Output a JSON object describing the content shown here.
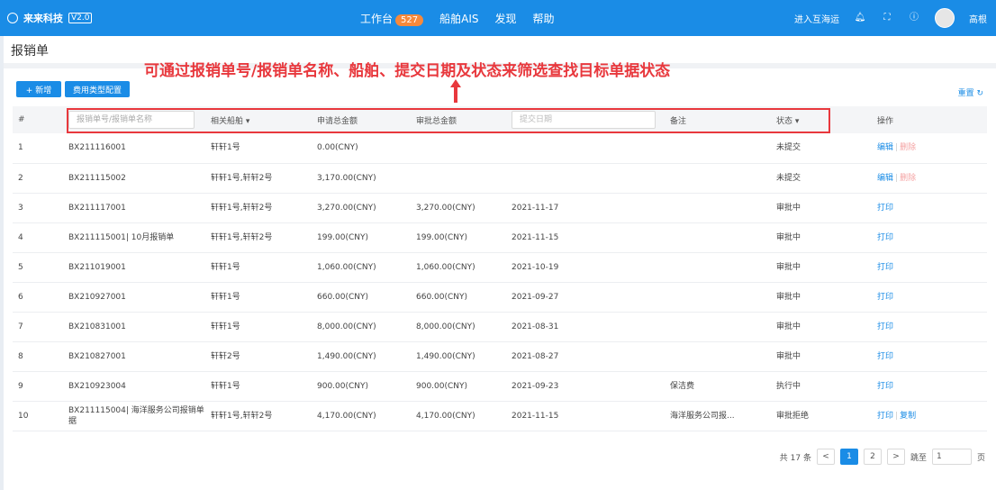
{
  "topbar": {
    "brand_name": "来来科技",
    "brand_version": "V2.0",
    "nav": [
      {
        "label": "工作台",
        "badge": "527"
      },
      {
        "label": "船舶AIS"
      },
      {
        "label": "发现"
      },
      {
        "label": "帮助"
      }
    ],
    "enter_label": "进入互海运",
    "user_name": "高根"
  },
  "page": {
    "title": "报销单",
    "annotation": "可通过报销单号/报销单名称、船舶、提交日期及状态来筛选查找目标单据状态",
    "new_button": "+ 新增",
    "config_button": "费用类型配置",
    "reset_label": "重置"
  },
  "table": {
    "headers": {
      "index": "#",
      "no_placeholder": "报销单号/报销单名称",
      "ship": "相关船舶",
      "apply_amount": "申请总金额",
      "approve_amount": "审批总金额",
      "date_placeholder": "提交日期",
      "remark": "备注",
      "status": "状态",
      "action": "操作"
    },
    "rows": [
      {
        "idx": "1",
        "no": "BX211116001",
        "ship": "轩轩1号",
        "apply": "0.00(CNY)",
        "approve": "",
        "date": "",
        "remark": "",
        "status": "未提交",
        "act1": "编辑",
        "act2": "删除"
      },
      {
        "idx": "2",
        "no": "BX211115002",
        "ship": "轩轩1号,轩轩2号",
        "apply": "3,170.00(CNY)",
        "approve": "",
        "date": "",
        "remark": "",
        "status": "未提交",
        "act1": "编辑",
        "act2": "删除"
      },
      {
        "idx": "3",
        "no": "BX211117001",
        "ship": "轩轩1号,轩轩2号",
        "apply": "3,270.00(CNY)",
        "approve": "3,270.00(CNY)",
        "date": "2021-11-17",
        "remark": "",
        "status": "审批中",
        "act1": "打印",
        "act2": ""
      },
      {
        "idx": "4",
        "no": "BX211115001| 10月报销单",
        "ship": "轩轩1号,轩轩2号",
        "apply": "199.00(CNY)",
        "approve": "199.00(CNY)",
        "date": "2021-11-15",
        "remark": "",
        "status": "审批中",
        "act1": "打印",
        "act2": ""
      },
      {
        "idx": "5",
        "no": "BX211019001",
        "ship": "轩轩1号",
        "apply": "1,060.00(CNY)",
        "approve": "1,060.00(CNY)",
        "date": "2021-10-19",
        "remark": "",
        "status": "审批中",
        "act1": "打印",
        "act2": ""
      },
      {
        "idx": "6",
        "no": "BX210927001",
        "ship": "轩轩1号",
        "apply": "660.00(CNY)",
        "approve": "660.00(CNY)",
        "date": "2021-09-27",
        "remark": "",
        "status": "审批中",
        "act1": "打印",
        "act2": ""
      },
      {
        "idx": "7",
        "no": "BX210831001",
        "ship": "轩轩1号",
        "apply": "8,000.00(CNY)",
        "approve": "8,000.00(CNY)",
        "date": "2021-08-31",
        "remark": "",
        "status": "审批中",
        "act1": "打印",
        "act2": ""
      },
      {
        "idx": "8",
        "no": "BX210827001",
        "ship": "轩轩2号",
        "apply": "1,490.00(CNY)",
        "approve": "1,490.00(CNY)",
        "date": "2021-08-27",
        "remark": "",
        "status": "审批中",
        "act1": "打印",
        "act2": ""
      },
      {
        "idx": "9",
        "no": "BX210923004",
        "ship": "轩轩1号",
        "apply": "900.00(CNY)",
        "approve": "900.00(CNY)",
        "date": "2021-09-23",
        "remark": "保洁费",
        "status": "执行中",
        "act1": "打印",
        "act2": ""
      },
      {
        "idx": "10",
        "no": "BX211115004| 海洋服务公司报销单据",
        "ship": "轩轩1号,轩轩2号",
        "apply": "4,170.00(CNY)",
        "approve": "4,170.00(CNY)",
        "date": "2021-11-15",
        "remark": "海洋服务公司报...",
        "status": "审批拒绝",
        "act1": "打印",
        "act2": "复制"
      }
    ]
  },
  "pager": {
    "total": "共 17 条",
    "prev": "<",
    "pages": [
      "1",
      "2"
    ],
    "next": ">",
    "jump_label": "跳至",
    "jump_value": "1",
    "page_unit": "页"
  },
  "colors": {
    "primary": "#1a8ce6",
    "annotation": "#e8383d",
    "badge": "#f7893b"
  }
}
